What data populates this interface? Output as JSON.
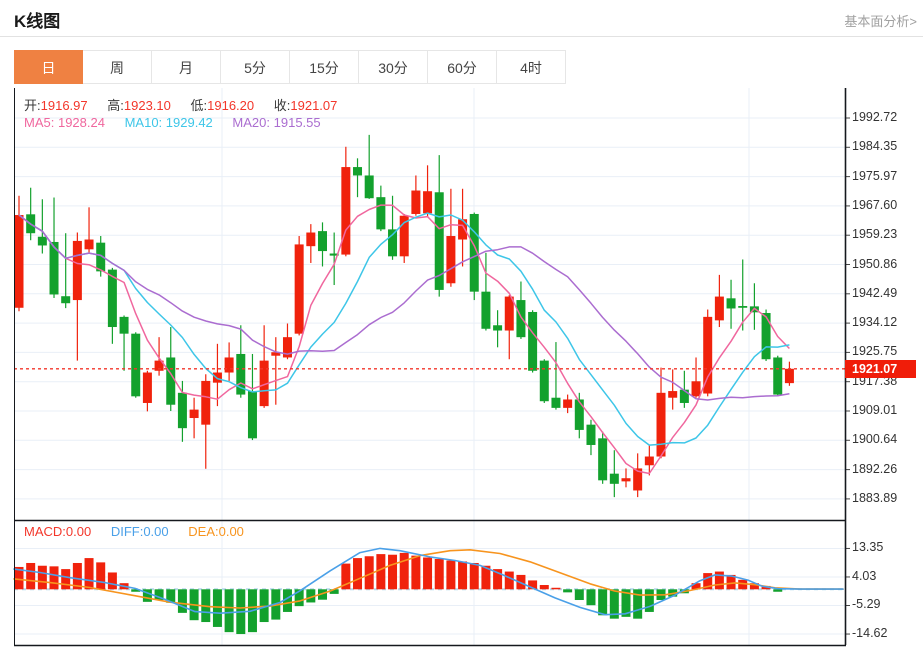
{
  "header": {
    "title": "K线图",
    "link": "基本面分析>"
  },
  "tabs": {
    "items": [
      "日",
      "周",
      "月",
      "5分",
      "15分",
      "30分",
      "60分",
      "4时"
    ],
    "active": "日",
    "active_index": 0
  },
  "main_overlay": {
    "ohlc": [
      {
        "k": "开:",
        "v": "1916.97"
      },
      {
        "k": "高:",
        "v": "1923.10"
      },
      {
        "k": "低:",
        "v": "1916.20"
      },
      {
        "k": "收:",
        "v": "1921.07"
      }
    ],
    "ma": [
      {
        "k": "MA5:",
        "v": "1928.24"
      },
      {
        "k": "MA10:",
        "v": "1929.42"
      },
      {
        "k": "MA20:",
        "v": "1915.55"
      }
    ]
  },
  "macd_overlay": [
    {
      "k": "MACD:",
      "v": "0.00"
    },
    {
      "k": "DIFF:",
      "v": "0.00"
    },
    {
      "k": "DEA:",
      "v": "0.00"
    }
  ],
  "colors": {
    "up": "#f0220c",
    "down": "#13a12d",
    "ma5": "#f0679e",
    "ma10": "#3ec6e8",
    "ma20": "#ab6dd0",
    "diff_line": "#4aa0e8",
    "dea_line": "#f7941e",
    "grid": "#e9eff7",
    "zero_dash": "#b6d9ec",
    "last_price_line": "#f3362a",
    "badge_bg": "#f01d09",
    "tab_active": "#ef8142",
    "axis_text": "#333333",
    "frame": "#15181d"
  },
  "chart_data": {
    "type": "candlestick+macd",
    "main": {
      "y_ticks": [
        1992.72,
        1984.35,
        1975.97,
        1967.6,
        1959.23,
        1950.86,
        1942.49,
        1934.12,
        1925.75,
        1917.38,
        1909.01,
        1900.64,
        1892.26,
        1883.89
      ],
      "last_price": 1921.07,
      "last_price_label": "1921.07",
      "ma_windows": [
        5,
        10,
        20
      ],
      "candles_format": [
        "open",
        "high",
        "low",
        "close"
      ],
      "candles": [
        [
          1938.5,
          1970.5,
          1937.5,
          1965.0
        ],
        [
          1965.2,
          1972.8,
          1957.8,
          1959.8
        ],
        [
          1958.8,
          1969.5,
          1954.0,
          1956.3
        ],
        [
          1957.3,
          1970.0,
          1941.3,
          1942.3
        ],
        [
          1941.8,
          1959.8,
          1938.4,
          1939.8
        ],
        [
          1940.7,
          1960.0,
          1923.4,
          1957.6
        ],
        [
          1955.2,
          1967.2,
          1954.0,
          1958.0
        ],
        [
          1957.1,
          1959.0,
          1947.4,
          1948.9
        ],
        [
          1949.4,
          1949.9,
          1928.2,
          1933.0
        ],
        [
          1935.9,
          1936.3,
          1920.5,
          1931.1
        ],
        [
          1931.1,
          1931.5,
          1912.8,
          1913.2
        ],
        [
          1911.3,
          1920.5,
          1908.9,
          1920.0
        ],
        [
          1920.5,
          1930.1,
          1919.1,
          1923.4
        ],
        [
          1924.3,
          1933.0,
          1909.0,
          1910.8
        ],
        [
          1914.2,
          1917.6,
          1900.2,
          1904.1
        ],
        [
          1907.0,
          1912.8,
          1901.2,
          1909.4
        ],
        [
          1905.1,
          1919.5,
          1892.5,
          1917.6
        ],
        [
          1917.1,
          1928.2,
          1910.4,
          1920.0
        ],
        [
          1920.0,
          1928.6,
          1917.6,
          1924.3
        ],
        [
          1925.3,
          1933.5,
          1912.8,
          1913.7
        ],
        [
          1914.7,
          1925.3,
          1900.7,
          1901.2
        ],
        [
          1910.4,
          1933.5,
          1909.9,
          1923.4
        ],
        [
          1924.8,
          1930.1,
          1910.8,
          1925.8
        ],
        [
          1924.3,
          1934.0,
          1923.8,
          1930.1
        ],
        [
          1931.1,
          1959.0,
          1930.6,
          1956.6
        ],
        [
          1956.1,
          1962.4,
          1951.3,
          1960.0
        ],
        [
          1960.4,
          1962.9,
          1950.3,
          1954.7
        ],
        [
          1954.0,
          1960.0,
          1945.0,
          1953.4
        ],
        [
          1953.7,
          1984.5,
          1953.2,
          1978.7
        ],
        [
          1978.7,
          1981.2,
          1970.1,
          1976.3
        ],
        [
          1976.3,
          1987.9,
          1969.6,
          1969.8
        ],
        [
          1970.1,
          1973.4,
          1960.4,
          1960.9
        ],
        [
          1960.9,
          1970.5,
          1952.2,
          1953.2
        ],
        [
          1953.2,
          1965.3,
          1951.3,
          1964.8
        ],
        [
          1965.3,
          1976.3,
          1964.8,
          1972.0
        ],
        [
          1965.5,
          1979.2,
          1964.3,
          1971.8
        ],
        [
          1971.5,
          1982.1,
          1941.7,
          1943.6
        ],
        [
          1945.5,
          1972.5,
          1944.5,
          1959.0
        ],
        [
          1958.0,
          1972.5,
          1950.3,
          1963.8
        ],
        [
          1965.3,
          1965.7,
          1940.7,
          1943.1
        ],
        [
          1943.1,
          1954.2,
          1932.0,
          1932.5
        ],
        [
          1933.5,
          1937.8,
          1927.2,
          1932.0
        ],
        [
          1932.0,
          1942.1,
          1923.8,
          1941.7
        ],
        [
          1940.7,
          1946.0,
          1929.6,
          1930.1
        ],
        [
          1937.3,
          1937.8,
          1920.0,
          1920.5
        ],
        [
          1923.4,
          1923.8,
          1911.3,
          1911.8
        ],
        [
          1912.8,
          1928.7,
          1909.4,
          1909.9
        ],
        [
          1909.9,
          1913.7,
          1908.4,
          1912.3
        ],
        [
          1912.3,
          1914.2,
          1901.2,
          1903.6
        ],
        [
          1905.1,
          1906.5,
          1896.4,
          1899.3
        ],
        [
          1901.2,
          1903.1,
          1888.2,
          1889.2
        ],
        [
          1891.1,
          1897.8,
          1884.4,
          1888.2
        ],
        [
          1888.9,
          1892.6,
          1887.2,
          1889.8
        ],
        [
          1886.3,
          1896.9,
          1884.4,
          1892.6
        ],
        [
          1893.5,
          1899.3,
          1890.6,
          1896.0
        ],
        [
          1896.0,
          1921.4,
          1895.5,
          1914.2
        ],
        [
          1912.8,
          1920.9,
          1909.4,
          1914.7
        ],
        [
          1915.1,
          1920.5,
          1909.9,
          1911.3
        ],
        [
          1913.2,
          1924.3,
          1912.8,
          1917.5
        ],
        [
          1914.0,
          1938.0,
          1913.2,
          1935.9
        ],
        [
          1934.9,
          1947.9,
          1933.0,
          1941.7
        ],
        [
          1941.2,
          1946.5,
          1932.5,
          1938.3
        ],
        [
          1939.0,
          1952.3,
          1932.0,
          1938.5
        ],
        [
          1938.9,
          1945.5,
          1932.2,
          1937.2
        ],
        [
          1937.0,
          1938.0,
          1923.3,
          1923.8
        ],
        [
          1924.3,
          1924.8,
          1913.2,
          1913.7
        ],
        [
          1916.97,
          1923.1,
          1916.2,
          1921.07
        ]
      ]
    },
    "macd": {
      "y_ticks": [
        13.35,
        4.03,
        -5.29,
        -14.62
      ],
      "histogram": [
        7.3,
        8.6,
        7.7,
        7.5,
        6.6,
        8.6,
        10.2,
        8.8,
        5.5,
        2.0,
        -0.8,
        -4.1,
        -3.5,
        -4.4,
        -7.7,
        -10.1,
        -10.7,
        -12.3,
        -14.0,
        -14.62,
        -14.0,
        -10.7,
        -9.9,
        -7.4,
        -5.5,
        -4.3,
        -3.4,
        -1.5,
        8.4,
        10.2,
        10.8,
        11.5,
        11.3,
        11.9,
        11.0,
        10.4,
        9.9,
        9.4,
        9.1,
        8.6,
        7.7,
        6.6,
        5.8,
        4.7,
        2.9,
        1.4,
        0.5,
        -1.0,
        -3.5,
        -5.2,
        -8.5,
        -9.6,
        -9.0,
        -9.6,
        -7.4,
        -3.5,
        -2.4,
        -1.3,
        2.0,
        5.3,
        5.8,
        4.7,
        3.1,
        2.0,
        1.1,
        -0.8,
        0.0
      ],
      "diff_line": [
        [
          14,
          6.6
        ],
        [
          40,
          5.5
        ],
        [
          70,
          3.8
        ],
        [
          105,
          2.2
        ],
        [
          135,
          0.3
        ],
        [
          165,
          -3.3
        ],
        [
          195,
          -7.3
        ],
        [
          220,
          -7.8
        ],
        [
          250,
          -7.2
        ],
        [
          280,
          -4.3
        ],
        [
          300,
          -0.5
        ],
        [
          330,
          6.0
        ],
        [
          360,
          12.0
        ],
        [
          380,
          13.35
        ],
        [
          400,
          12.6
        ],
        [
          430,
          10.6
        ],
        [
          455,
          9.4
        ],
        [
          480,
          7.8
        ],
        [
          505,
          4.4
        ],
        [
          530,
          0.8
        ],
        [
          555,
          -2.8
        ],
        [
          580,
          -5.9
        ],
        [
          605,
          -8.3
        ],
        [
          625,
          -8.0
        ],
        [
          650,
          -5.6
        ],
        [
          675,
          -1.9
        ],
        [
          700,
          2.8
        ],
        [
          715,
          4.7
        ],
        [
          732,
          4.3
        ],
        [
          748,
          3.0
        ],
        [
          762,
          1.0
        ],
        [
          778,
          0.2
        ],
        [
          800,
          0.05
        ],
        [
          843,
          0.05
        ]
      ],
      "dea_line": [
        [
          14,
          3.4
        ],
        [
          50,
          2.2
        ],
        [
          90,
          0.6
        ],
        [
          130,
          -1.8
        ],
        [
          170,
          -4.2
        ],
        [
          210,
          -5.7
        ],
        [
          240,
          -6.1
        ],
        [
          270,
          -5.5
        ],
        [
          300,
          -3.8
        ],
        [
          330,
          -0.6
        ],
        [
          360,
          3.6
        ],
        [
          390,
          7.8
        ],
        [
          420,
          11.0
        ],
        [
          450,
          12.6
        ],
        [
          470,
          12.9
        ],
        [
          500,
          11.7
        ],
        [
          530,
          9.0
        ],
        [
          560,
          5.4
        ],
        [
          590,
          1.8
        ],
        [
          615,
          -0.6
        ],
        [
          640,
          -1.9
        ],
        [
          665,
          -1.8
        ],
        [
          690,
          -0.4
        ],
        [
          715,
          1.4
        ],
        [
          735,
          2.1
        ],
        [
          755,
          1.5
        ],
        [
          775,
          0.5
        ],
        [
          800,
          0.05
        ],
        [
          843,
          0.05
        ]
      ]
    }
  }
}
